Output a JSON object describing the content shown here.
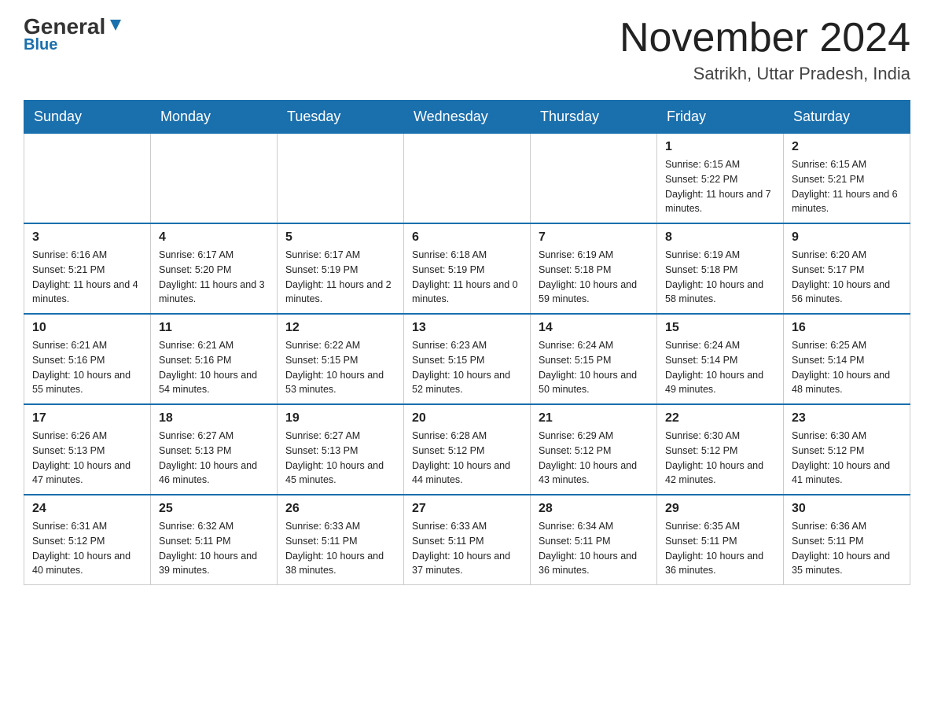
{
  "header": {
    "logo_main": "General",
    "logo_sub": "Blue",
    "month_title": "November 2024",
    "location": "Satrikh, Uttar Pradesh, India"
  },
  "days_of_week": [
    "Sunday",
    "Monday",
    "Tuesday",
    "Wednesday",
    "Thursday",
    "Friday",
    "Saturday"
  ],
  "weeks": [
    {
      "days": [
        {
          "num": "",
          "info": ""
        },
        {
          "num": "",
          "info": ""
        },
        {
          "num": "",
          "info": ""
        },
        {
          "num": "",
          "info": ""
        },
        {
          "num": "",
          "info": ""
        },
        {
          "num": "1",
          "info": "Sunrise: 6:15 AM\nSunset: 5:22 PM\nDaylight: 11 hours and 7 minutes."
        },
        {
          "num": "2",
          "info": "Sunrise: 6:15 AM\nSunset: 5:21 PM\nDaylight: 11 hours and 6 minutes."
        }
      ]
    },
    {
      "days": [
        {
          "num": "3",
          "info": "Sunrise: 6:16 AM\nSunset: 5:21 PM\nDaylight: 11 hours and 4 minutes."
        },
        {
          "num": "4",
          "info": "Sunrise: 6:17 AM\nSunset: 5:20 PM\nDaylight: 11 hours and 3 minutes."
        },
        {
          "num": "5",
          "info": "Sunrise: 6:17 AM\nSunset: 5:19 PM\nDaylight: 11 hours and 2 minutes."
        },
        {
          "num": "6",
          "info": "Sunrise: 6:18 AM\nSunset: 5:19 PM\nDaylight: 11 hours and 0 minutes."
        },
        {
          "num": "7",
          "info": "Sunrise: 6:19 AM\nSunset: 5:18 PM\nDaylight: 10 hours and 59 minutes."
        },
        {
          "num": "8",
          "info": "Sunrise: 6:19 AM\nSunset: 5:18 PM\nDaylight: 10 hours and 58 minutes."
        },
        {
          "num": "9",
          "info": "Sunrise: 6:20 AM\nSunset: 5:17 PM\nDaylight: 10 hours and 56 minutes."
        }
      ]
    },
    {
      "days": [
        {
          "num": "10",
          "info": "Sunrise: 6:21 AM\nSunset: 5:16 PM\nDaylight: 10 hours and 55 minutes."
        },
        {
          "num": "11",
          "info": "Sunrise: 6:21 AM\nSunset: 5:16 PM\nDaylight: 10 hours and 54 minutes."
        },
        {
          "num": "12",
          "info": "Sunrise: 6:22 AM\nSunset: 5:15 PM\nDaylight: 10 hours and 53 minutes."
        },
        {
          "num": "13",
          "info": "Sunrise: 6:23 AM\nSunset: 5:15 PM\nDaylight: 10 hours and 52 minutes."
        },
        {
          "num": "14",
          "info": "Sunrise: 6:24 AM\nSunset: 5:15 PM\nDaylight: 10 hours and 50 minutes."
        },
        {
          "num": "15",
          "info": "Sunrise: 6:24 AM\nSunset: 5:14 PM\nDaylight: 10 hours and 49 minutes."
        },
        {
          "num": "16",
          "info": "Sunrise: 6:25 AM\nSunset: 5:14 PM\nDaylight: 10 hours and 48 minutes."
        }
      ]
    },
    {
      "days": [
        {
          "num": "17",
          "info": "Sunrise: 6:26 AM\nSunset: 5:13 PM\nDaylight: 10 hours and 47 minutes."
        },
        {
          "num": "18",
          "info": "Sunrise: 6:27 AM\nSunset: 5:13 PM\nDaylight: 10 hours and 46 minutes."
        },
        {
          "num": "19",
          "info": "Sunrise: 6:27 AM\nSunset: 5:13 PM\nDaylight: 10 hours and 45 minutes."
        },
        {
          "num": "20",
          "info": "Sunrise: 6:28 AM\nSunset: 5:12 PM\nDaylight: 10 hours and 44 minutes."
        },
        {
          "num": "21",
          "info": "Sunrise: 6:29 AM\nSunset: 5:12 PM\nDaylight: 10 hours and 43 minutes."
        },
        {
          "num": "22",
          "info": "Sunrise: 6:30 AM\nSunset: 5:12 PM\nDaylight: 10 hours and 42 minutes."
        },
        {
          "num": "23",
          "info": "Sunrise: 6:30 AM\nSunset: 5:12 PM\nDaylight: 10 hours and 41 minutes."
        }
      ]
    },
    {
      "days": [
        {
          "num": "24",
          "info": "Sunrise: 6:31 AM\nSunset: 5:12 PM\nDaylight: 10 hours and 40 minutes."
        },
        {
          "num": "25",
          "info": "Sunrise: 6:32 AM\nSunset: 5:11 PM\nDaylight: 10 hours and 39 minutes."
        },
        {
          "num": "26",
          "info": "Sunrise: 6:33 AM\nSunset: 5:11 PM\nDaylight: 10 hours and 38 minutes."
        },
        {
          "num": "27",
          "info": "Sunrise: 6:33 AM\nSunset: 5:11 PM\nDaylight: 10 hours and 37 minutes."
        },
        {
          "num": "28",
          "info": "Sunrise: 6:34 AM\nSunset: 5:11 PM\nDaylight: 10 hours and 36 minutes."
        },
        {
          "num": "29",
          "info": "Sunrise: 6:35 AM\nSunset: 5:11 PM\nDaylight: 10 hours and 36 minutes."
        },
        {
          "num": "30",
          "info": "Sunrise: 6:36 AM\nSunset: 5:11 PM\nDaylight: 10 hours and 35 minutes."
        }
      ]
    }
  ]
}
